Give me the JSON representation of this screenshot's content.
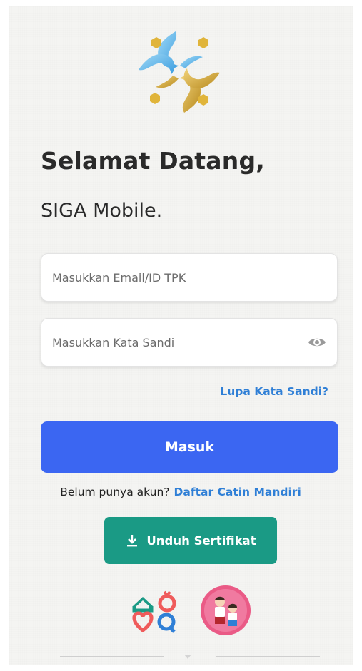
{
  "app": {
    "greeting": "Selamat Datang,",
    "app_name": "SIGA Mobile."
  },
  "login": {
    "email_placeholder": "Masukkan Email/ID TPK",
    "email_value": "",
    "password_placeholder": "Masukkan Kata Sandi",
    "password_value": "",
    "forgot_password": "Lupa Kata Sandi?",
    "submit_label": "Masuk"
  },
  "register": {
    "question": "Belum punya akun?",
    "link_label": "Daftar Catin Mandiri"
  },
  "download": {
    "label": "Unduh Sertifikat",
    "icon": "download-icon"
  },
  "icons": {
    "password_toggle": "eye-icon",
    "logo": "siga-logo",
    "partner_logos": [
      "family-logo",
      "children-badge"
    ],
    "bottom": "chevron-down-icon"
  },
  "colors": {
    "primary": "#3b66f2",
    "link": "#2f7fd6",
    "download": "#1a9a85",
    "text": "#2a2a2a"
  }
}
